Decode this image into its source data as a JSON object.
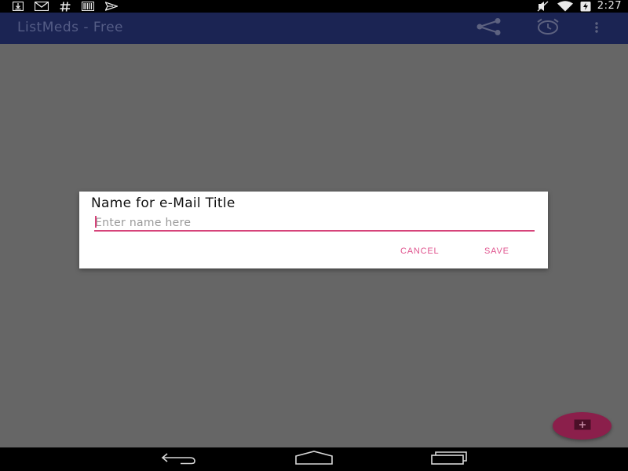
{
  "status_bar": {
    "time": "2:27",
    "left_icons": [
      "download-icon",
      "gmail-icon",
      "hashtag-icon",
      "barcode-icon",
      "send-icon"
    ],
    "right_icons": [
      "vibrate-muted-icon",
      "wifi-icon",
      "battery-charging-icon"
    ]
  },
  "app_bar": {
    "title": "ListMeds - Free",
    "actions": [
      "share-icon",
      "alarm-icon",
      "more-vert-icon"
    ]
  },
  "dialog": {
    "title": "Name for e-Mail Title",
    "input": {
      "value": "",
      "placeholder": "Enter name here"
    },
    "cancel_label": "CANCEL",
    "save_label": "SAVE"
  },
  "fab": {
    "icon": "add-icon"
  },
  "nav_bar": {
    "buttons": [
      "back-icon",
      "home-icon",
      "recents-icon"
    ]
  },
  "colors": {
    "app_bar": "#1b2453",
    "accent": "#e0558f",
    "fab": "#8b1f4b",
    "scrim": "#666666"
  }
}
